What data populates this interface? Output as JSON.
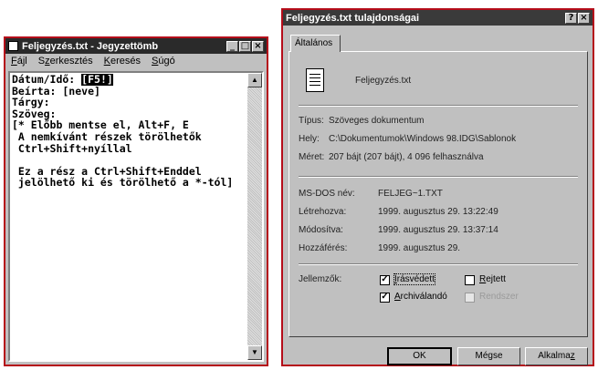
{
  "notepad": {
    "title": "Feljegyzés.txt - Jegyzettömb",
    "menu": [
      {
        "pre": "",
        "u": "F",
        "post": "ájl"
      },
      {
        "pre": "S",
        "u": "z",
        "post": "erkesztés"
      },
      {
        "pre": "",
        "u": "K",
        "post": "eresés"
      },
      {
        "pre": "",
        "u": "S",
        "post": "úgó"
      }
    ],
    "lines": {
      "l1_pre": "Dátum/Idő: ",
      "l1_hl": "[F5!]",
      "rest": "Beírta: [neve]\nTárgy:\nSzöveg:\n[* Előbb mentse el, Alt+F, E\n A nemkívánt részek törölhetők\n Ctrl+Shift+nyíllal\n\n Ez a rész a Ctrl+Shift+Enddel\n jelölhető ki és törölhető a *-tól]"
    }
  },
  "props": {
    "title": "Feljegyzés.txt tulajdonságai",
    "tab": "Általános",
    "filename": "Feljegyzés.txt",
    "rows1": [
      {
        "label": "Típus:",
        "value": "Szöveges dokumentum"
      },
      {
        "label": "Hely:",
        "value": "C:\\Dokumentumok\\Windows 98.IDG\\Sablonok"
      },
      {
        "label": "Méret:",
        "value": "207 bájt (207 bájt), 4 096 felhasználva"
      }
    ],
    "rows2": [
      {
        "label": "MS-DOS név:",
        "value": "FELJEG~1.TXT"
      },
      {
        "label": "Létrehozva:",
        "value": "1999. augusztus 29. 13:22:49"
      },
      {
        "label": "Módosítva:",
        "value": "1999. augusztus 29. 13:37:14"
      },
      {
        "label": "Hozzáférés:",
        "value": "1999. augusztus 29."
      }
    ],
    "attr_label": "Jellemzők:",
    "attributes": {
      "readonly": {
        "pre": "",
        "u": "Í",
        "post": "rásvédett",
        "checked": true
      },
      "hidden": {
        "pre": "",
        "u": "R",
        "post": "ejtett",
        "checked": false
      },
      "archive": {
        "pre": "",
        "u": "A",
        "post": "rchiválandó",
        "checked": true
      },
      "system": {
        "pre": "",
        "u": "",
        "post": "Rendszer",
        "checked": false
      }
    },
    "buttons": {
      "ok": "OK",
      "cancel": "Mégse",
      "apply_pre": "Alkalma",
      "apply_u": "z"
    }
  }
}
